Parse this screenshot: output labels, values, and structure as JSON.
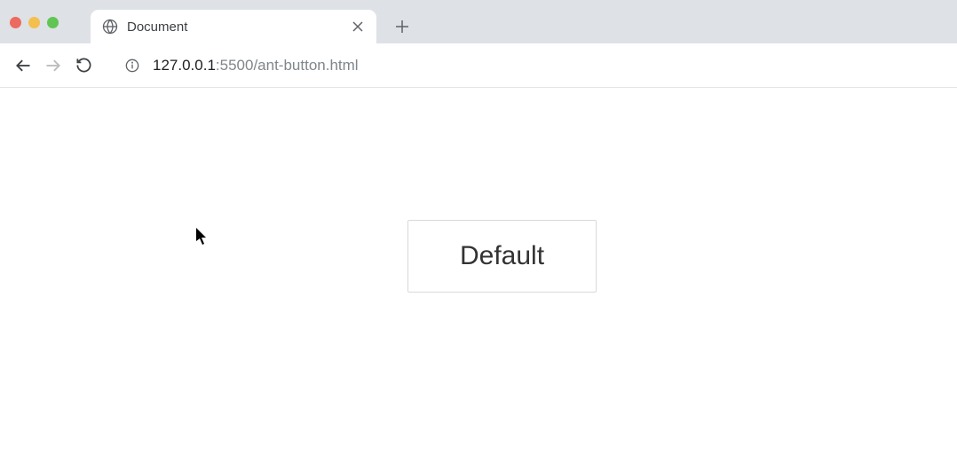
{
  "tab": {
    "title": "Document"
  },
  "url": {
    "host_dark": "127.0.0.1",
    "host_light": ":5500",
    "path": "/ant-button.html"
  },
  "page": {
    "button_label": "Default"
  }
}
